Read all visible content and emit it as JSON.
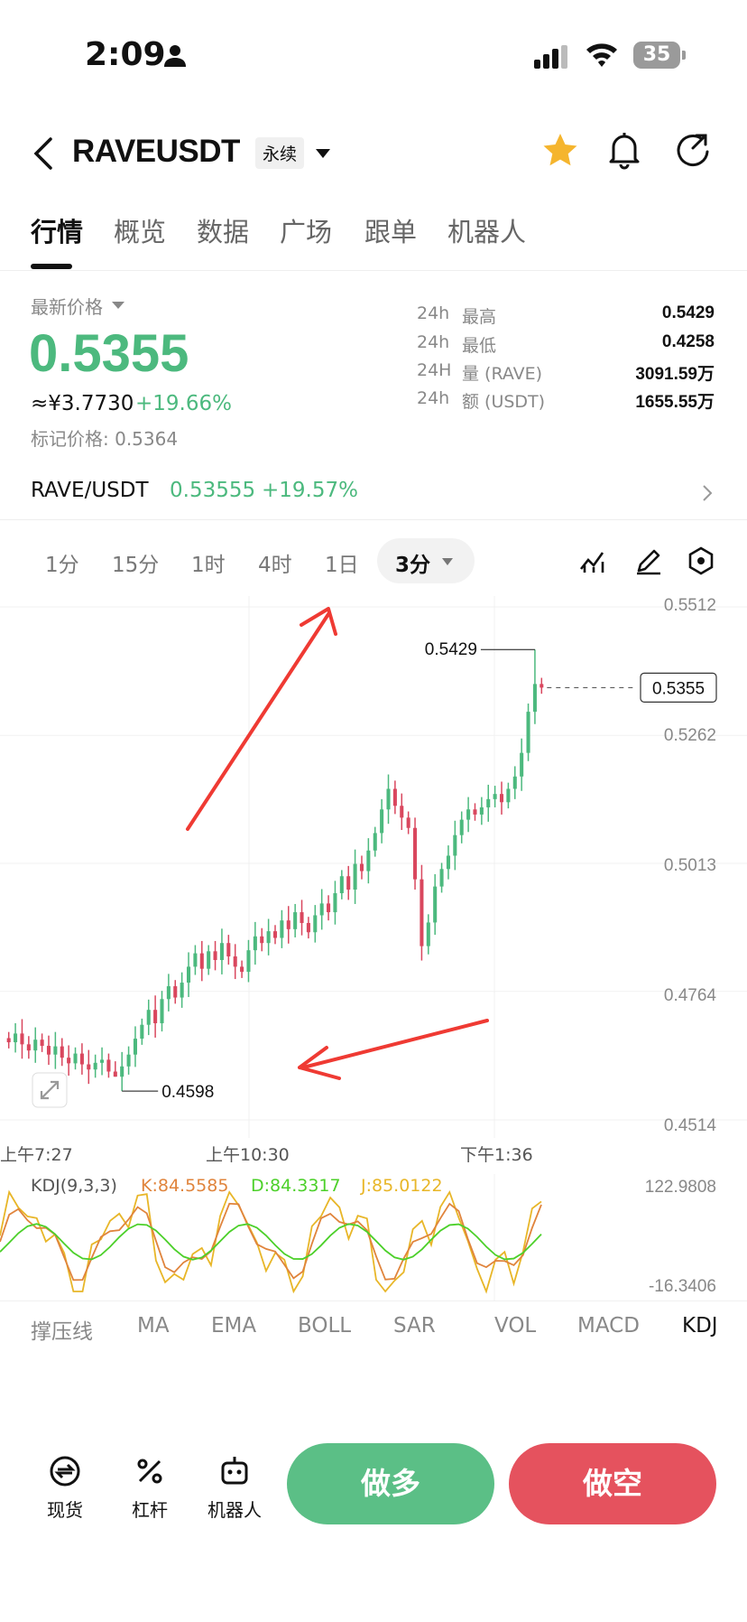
{
  "status_bar": {
    "time": "2:09",
    "battery": "35"
  },
  "header": {
    "pair": "RAVEUSDT",
    "contract_type": "永续"
  },
  "tabs": [
    {
      "label": "行情"
    },
    {
      "label": "概览"
    },
    {
      "label": "数据"
    },
    {
      "label": "广场"
    },
    {
      "label": "跟单"
    },
    {
      "label": "机器人"
    }
  ],
  "price": {
    "label": "最新价格",
    "last": "0.5355",
    "cny": "≈¥3.7730",
    "change_pct": "+19.66%",
    "mark_price": "标记价格: 0.5364"
  },
  "stats": [
    {
      "period": "24h",
      "name": "最高",
      "value": "0.5429"
    },
    {
      "period": "24h",
      "name": "最低",
      "value": "0.4258"
    },
    {
      "period": "24H",
      "name": "量 (RAVE)",
      "value": "3091.59万"
    },
    {
      "period": "24h",
      "name": "额 (USDT)",
      "value": "1655.55万"
    }
  ],
  "spot": {
    "pair": "RAVE/USDT",
    "price": "0.53555",
    "change_pct": "+19.57%"
  },
  "intervals": [
    {
      "label": "1分"
    },
    {
      "label": "15分"
    },
    {
      "label": "1时"
    },
    {
      "label": "4时"
    },
    {
      "label": "1日"
    },
    {
      "label": "3分"
    }
  ],
  "chart_data": {
    "type": "candlestick",
    "interval": "3分",
    "y_axis_labels": [
      "0.5512",
      "0.5262",
      "0.5013",
      "0.4764",
      "0.4514"
    ],
    "ylim": [
      0.4514,
      0.5512
    ],
    "x_axis_labels": [
      "上午7:27",
      "上午10:30",
      "下午1:36"
    ],
    "high_marker": "0.5429",
    "low_marker": "0.4598",
    "last_price_tag": "0.5355",
    "closes": [
      0.4665,
      0.4682,
      0.4661,
      0.4649,
      0.467,
      0.4658,
      0.4641,
      0.4657,
      0.4635,
      0.4624,
      0.4643,
      0.4622,
      0.4612,
      0.4625,
      0.4631,
      0.4608,
      0.4598,
      0.4618,
      0.4641,
      0.4672,
      0.4699,
      0.4728,
      0.4702,
      0.4749,
      0.4774,
      0.4752,
      0.4781,
      0.4812,
      0.4838,
      0.4808,
      0.4842,
      0.4825,
      0.4858,
      0.4832,
      0.4812,
      0.4802,
      0.4844,
      0.4871,
      0.4858,
      0.4881,
      0.4868,
      0.4902,
      0.4885,
      0.4918,
      0.4897,
      0.4879,
      0.4912,
      0.4935,
      0.4918,
      0.4955,
      0.4988,
      0.4962,
      0.5012,
      0.4998,
      0.5038,
      0.5072,
      0.5118,
      0.5158,
      0.5125,
      0.5102,
      0.5082,
      0.4982,
      0.4852,
      0.4898,
      0.4968,
      0.5002,
      0.5028,
      0.5068,
      0.5098,
      0.5118,
      0.5108,
      0.5122,
      0.5138,
      0.5148,
      0.5132,
      0.5158,
      0.5182,
      0.5228,
      0.5308,
      0.5362,
      0.5355
    ],
    "kdj": {
      "params": "KDJ(9,3,3)",
      "k_label": "K:84.5585",
      "d_label": "D:84.3317",
      "j_label": "J:85.0122",
      "y_top": "122.9808",
      "y_bottom": "-16.3406",
      "k_color": "#e0843c",
      "d_color": "#4cd02a",
      "j_color": "#e8b628"
    }
  },
  "indicators": [
    {
      "label": "撑压线"
    },
    {
      "label": "MA"
    },
    {
      "label": "EMA"
    },
    {
      "label": "BOLL"
    },
    {
      "label": "SAR"
    },
    {
      "label": "VOL"
    },
    {
      "label": "MACD"
    },
    {
      "label": "KDJ"
    }
  ],
  "bottom_bar": {
    "spot_label": "现货",
    "leverage_label": "杠杆",
    "bot_label": "机器人",
    "long_label": "做多",
    "short_label": "做空"
  },
  "colors": {
    "up": "#4cb97e",
    "down": "#d9475e",
    "accent_star": "#f5b52e"
  }
}
